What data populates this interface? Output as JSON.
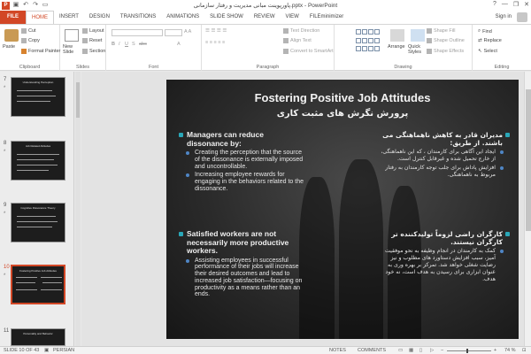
{
  "window": {
    "title": "پاورپوینت مبانی مدیریت و رفتار سازمانی.pptx - PowerPoint",
    "controls": [
      "?",
      "—",
      "❐",
      "✕"
    ]
  },
  "tabs": [
    "FILE",
    "HOME",
    "INSERT",
    "DESIGN",
    "TRANSITIONS",
    "ANIMATIONS",
    "SLIDE SHOW",
    "REVIEW",
    "VIEW",
    "FILEminimizer"
  ],
  "signin": "Sign in",
  "ribbon": {
    "clipboard": {
      "label": "Clipboard",
      "paste": "Paste",
      "cut": "Cut",
      "copy": "Copy",
      "format_painter": "Format Painter"
    },
    "slides": {
      "label": "Slides",
      "new_slide": "New Slide",
      "layout": "Layout",
      "reset": "Reset",
      "section": "Section"
    },
    "font": {
      "label": "Font"
    },
    "paragraph": {
      "label": "Paragraph",
      "text_direction": "Text Direction",
      "align_text": "Align Text",
      "convert_smartart": "Convert to SmartArt"
    },
    "drawing": {
      "label": "Drawing",
      "arrange": "Arrange",
      "quick_styles": "Quick Styles",
      "shape_fill": "Shape Fill",
      "shape_outline": "Shape Outline",
      "shape_effects": "Shape Effects"
    },
    "editing": {
      "label": "Editing",
      "find": "Find",
      "replace": "Replace",
      "select": "Select"
    }
  },
  "thumbnails": [
    {
      "num": "7",
      "title": "Understanding Perception"
    },
    {
      "num": "8",
      "title": "Job Related Attitudes"
    },
    {
      "num": "9",
      "title": "Cognitive Dissonance Theory"
    },
    {
      "num": "10",
      "title": "Fostering Positive Job Attitudes"
    },
    {
      "num": "11",
      "title": "Personality and Behavior"
    }
  ],
  "slide": {
    "title": "Fostering Positive Job Attitudes",
    "subtitle": "پرورش نگرش های مثبت کاری",
    "left": {
      "h1": "Managers can reduce dissonance by:",
      "b1": "Creating the perception that the source of the dissonance is externally imposed and uncontrollable.",
      "b2": "Increasing employee rewards for engaging in the behaviors related to the dissonance.",
      "h2": "Satisfied workers are not necessarily more productive workers.",
      "b3": "Assisting employees in successful performance of their jobs will increase their desired outcomes and lead to increased job satisfaction—focusing on productivity as a means rather than an ends."
    },
    "right": {
      "h1": "مدیران قادر به کاهش ناهماهنگی می باشند. از طریق:",
      "b1": "ایجاد این آگاهی برای کارمندان ، که این ناهماهنگی، از خارج تحمیل شده و غیرقابل کنترل است.",
      "b2": "افزایش پاداش برای جلب توجه کارمندان به رفتار مربوط به ناهماهنگی.",
      "h2": "کارگران راضی لزوماً تولیدکننده تر کارگران نیستند.",
      "b3": "کمک به کارمندان در انجام وظیفه به نحو موفقیت آمیز، سبب افزایش دستاورد های مطلوب و نیز رضایت شغلی خواهد شد. تمرکز بر بهره وری به عنوان ابزاری برای رسیدن به هدف است، نه خود هدف."
    }
  },
  "status": {
    "slide": "SLIDE 10 OF 43",
    "language": "PERSIAN",
    "notes": "NOTES",
    "comments": "COMMENTS",
    "zoom": "74 %"
  },
  "colors": {
    "accent": "#d24726",
    "slide_bg": "#2b2b2b",
    "bullet_teal": "#2aa7b8",
    "bullet_blue": "#4f86c6"
  }
}
